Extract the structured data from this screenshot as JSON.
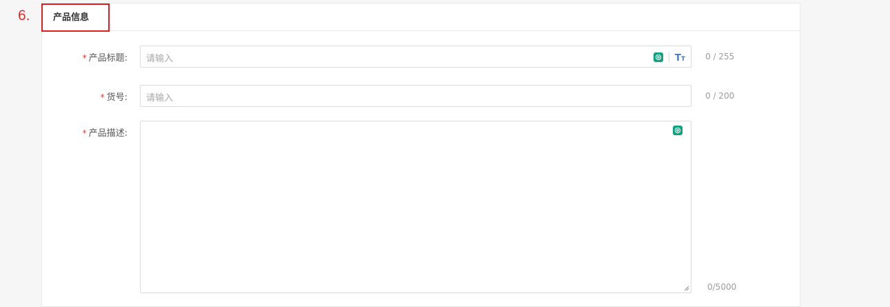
{
  "step_number": "6.",
  "section": {
    "title": "产品信息"
  },
  "fields": {
    "title": {
      "required_mark": "*",
      "label": "产品标题:",
      "placeholder": "请输入",
      "counter": "0 / 255"
    },
    "sku": {
      "required_mark": "*",
      "label": "货号:",
      "placeholder": "请输入",
      "counter": "0 / 200"
    },
    "description": {
      "required_mark": "*",
      "label": "产品描述:",
      "placeholder": "",
      "counter": "0/5000"
    }
  },
  "icons": {
    "ai": "openai-icon",
    "text_size": "text-size-icon",
    "ai_color": "#10a37f",
    "text_size_color": "#4a7cc9"
  },
  "colors": {
    "required": "#e53935",
    "highlight_border": "#e21d1d",
    "step_number": "#e52a2a"
  }
}
